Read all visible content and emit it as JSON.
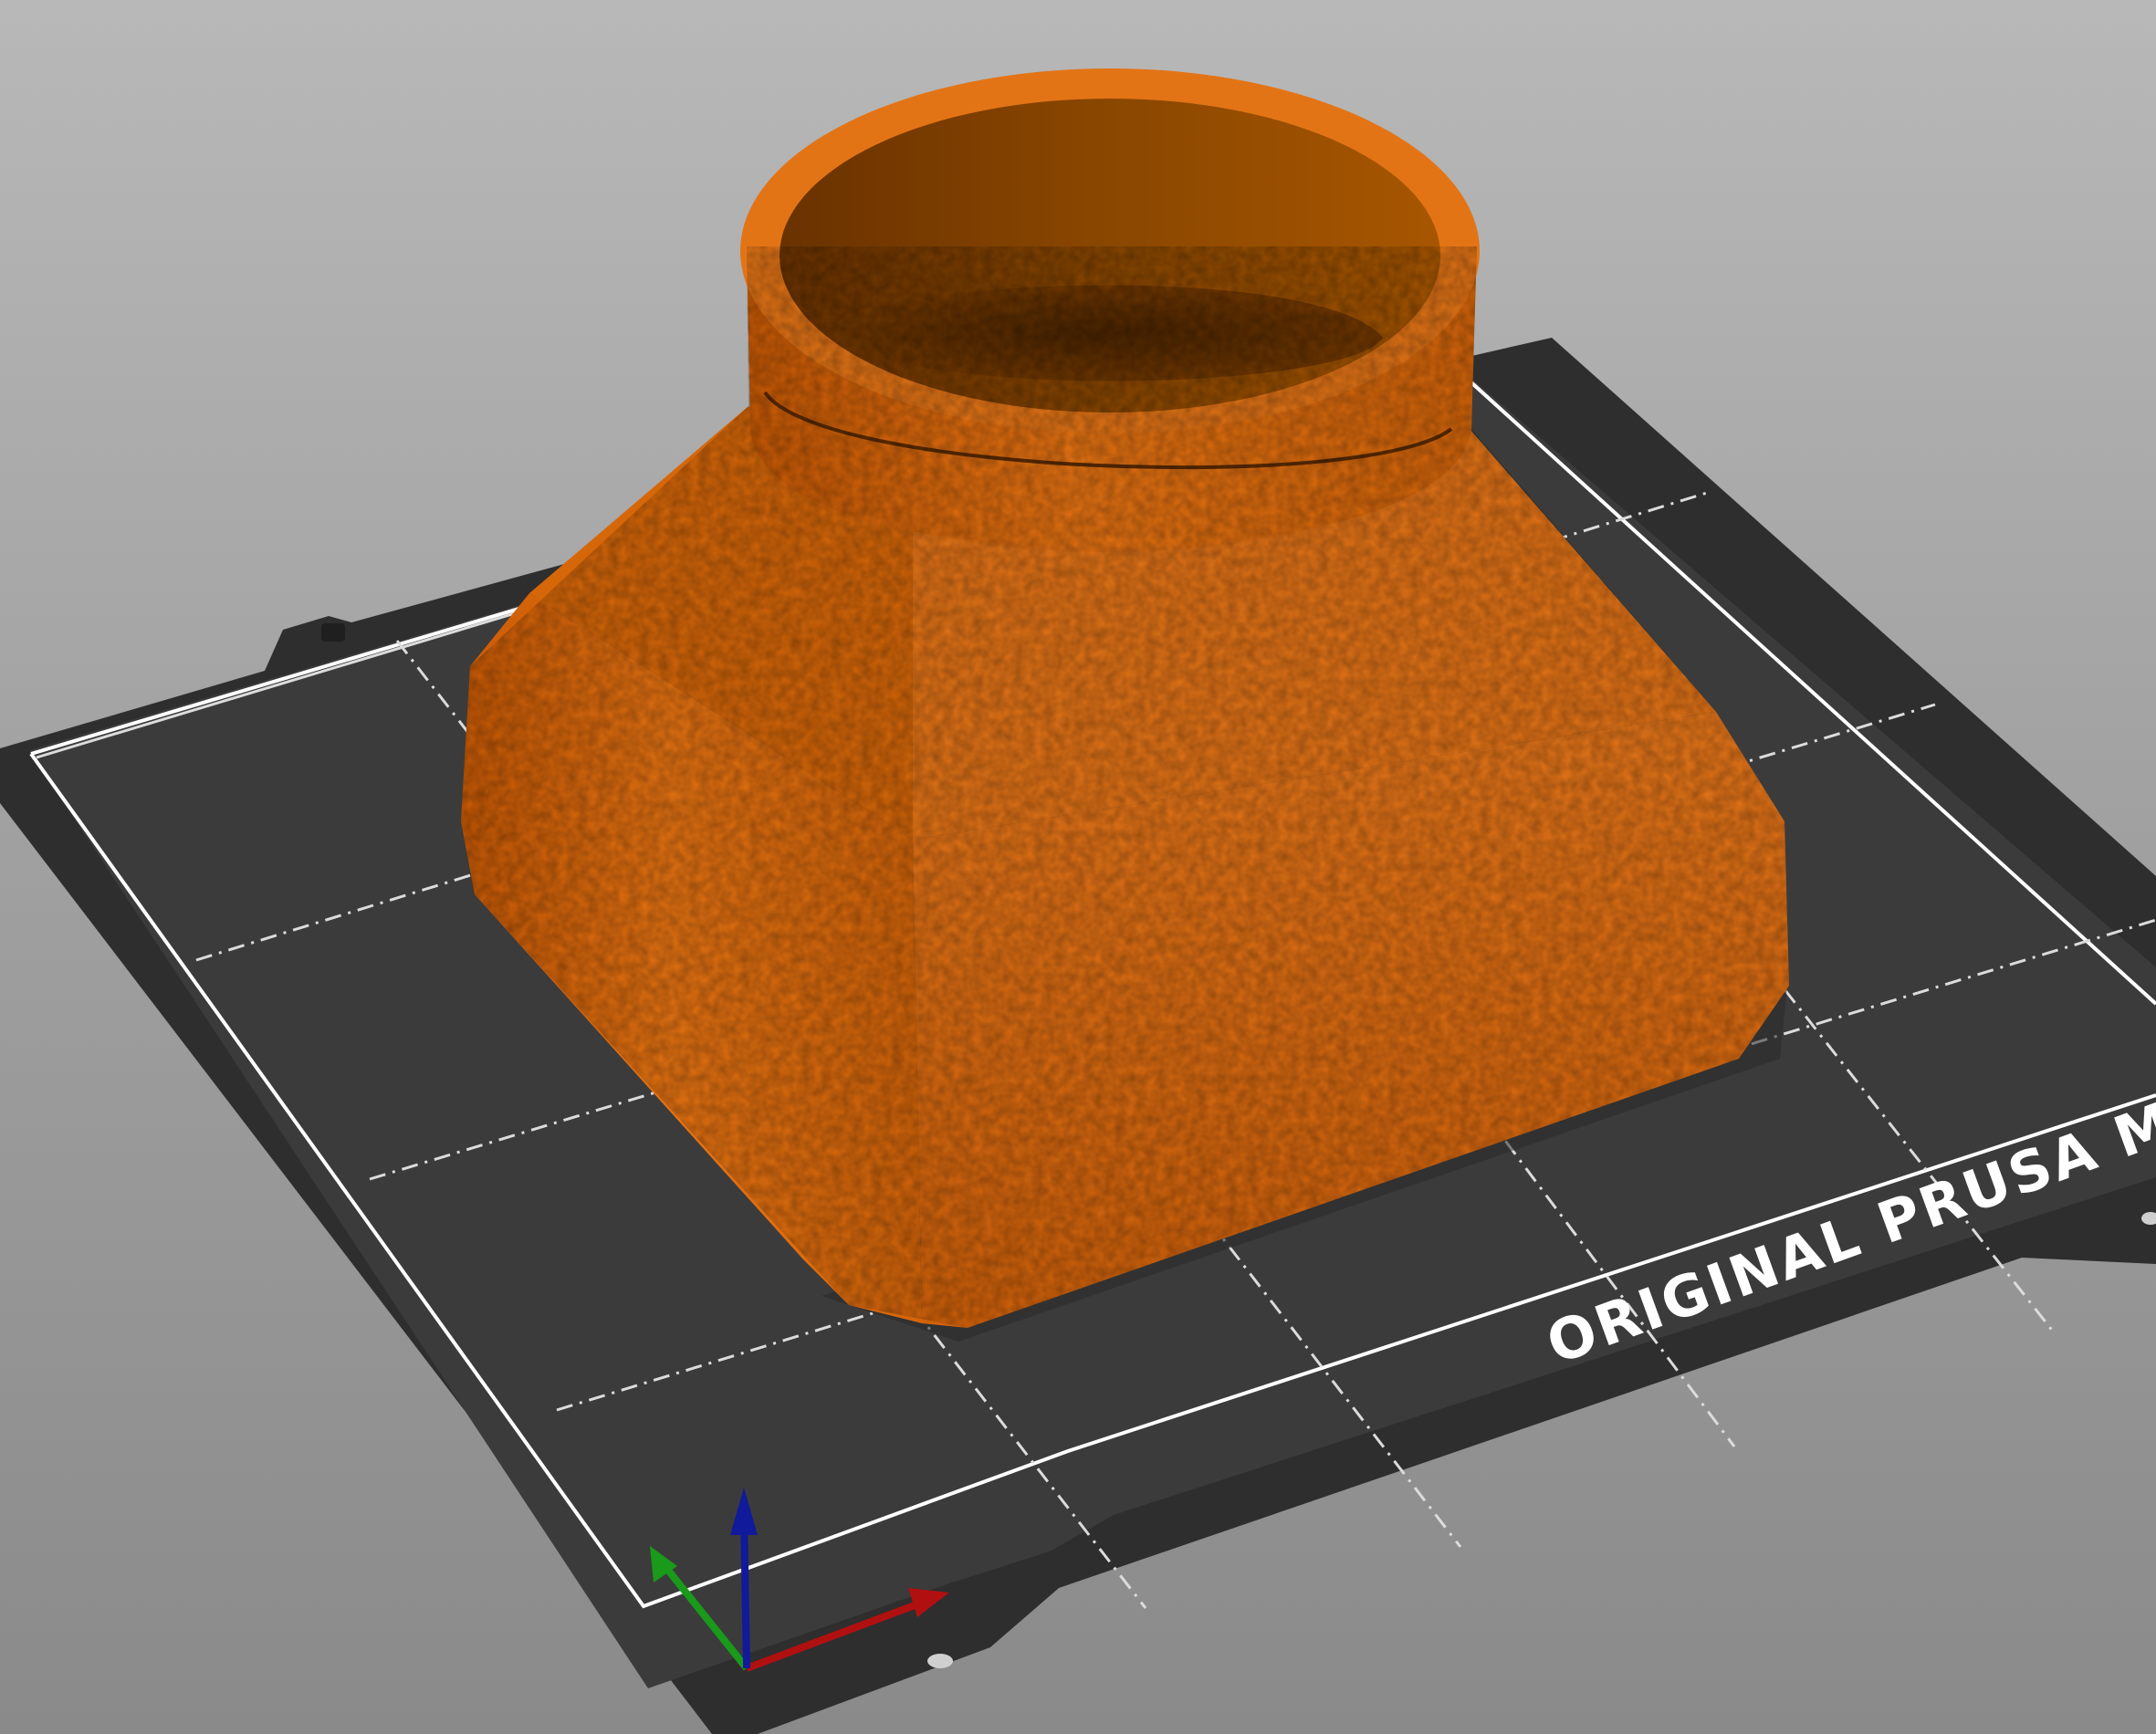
{
  "viewport": {
    "background_top": "#b8b8b8",
    "background_bottom": "#8a8a8a"
  },
  "bed": {
    "label": "ORIGINAL PRUSA MI",
    "plate_color": "#2e2e2e",
    "sheet_color": "#3b3b3b",
    "border_color": "#ffffff",
    "grid_line_color": "#e0e0e0"
  },
  "model": {
    "shape": "funnel-adapter",
    "color": "#e06b0a",
    "inner_color": "#8a4200"
  },
  "axes": {
    "x_color": "#b01010",
    "y_color": "#1a9a1a",
    "z_color": "#101a9a"
  }
}
